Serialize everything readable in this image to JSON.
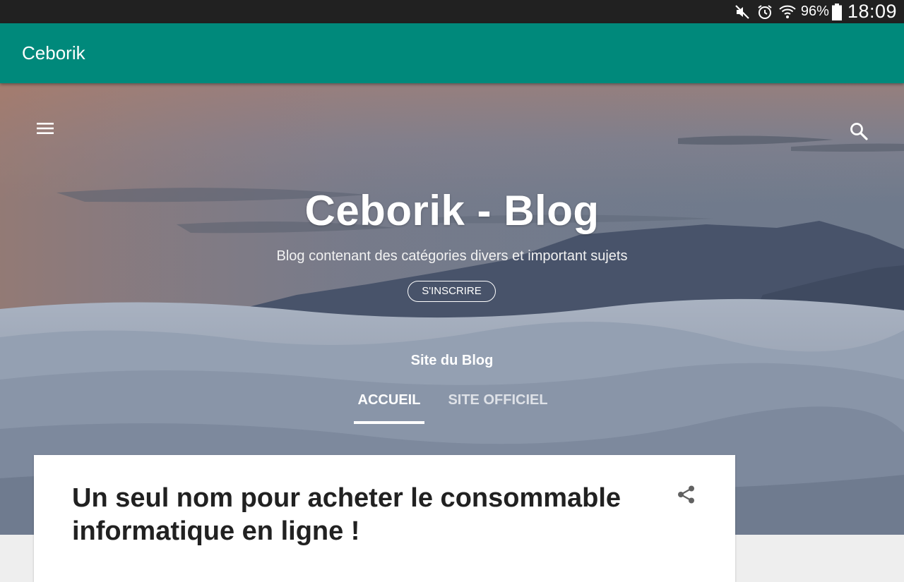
{
  "status_bar": {
    "icons": [
      "mute-icon",
      "alarm-icon",
      "wifi-icon",
      "battery-icon"
    ],
    "battery": "96%",
    "time": "18:09"
  },
  "app_bar": {
    "title": "Ceborik",
    "color": "#00897b"
  },
  "hero": {
    "menu_icon": "hamburger-menu-icon",
    "search_icon": "search-icon",
    "title": "Ceborik - Blog",
    "description": "Blog contenant des catégories divers et important sujets",
    "subscribe_label": "S'INSCRIRE",
    "pages_title": "Site du Blog",
    "tabs": [
      {
        "label": "ACCUEIL",
        "active": true
      },
      {
        "label": "SITE OFFICIEL",
        "active": false
      }
    ]
  },
  "post": {
    "title": "Un seul nom pour acheter le consommable informatique en ligne !",
    "share_icon": "share-icon"
  }
}
